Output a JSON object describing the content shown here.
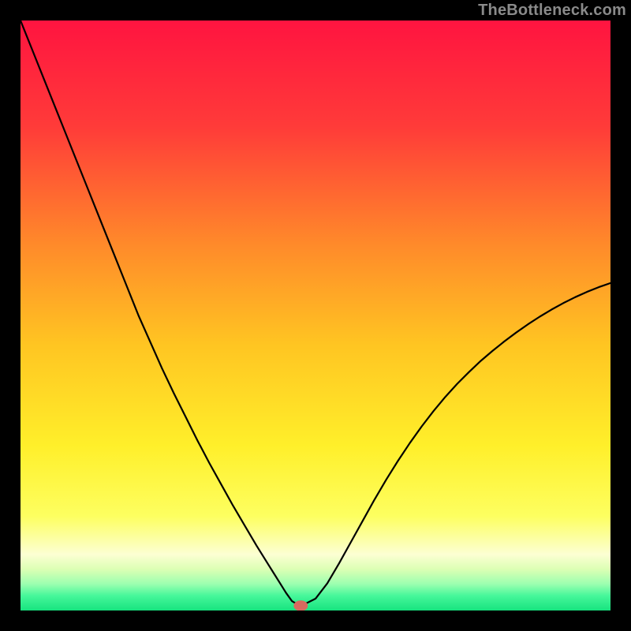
{
  "watermark": "TheBottleneck.com",
  "chart_data": {
    "type": "line",
    "title": "",
    "xlabel": "",
    "ylabel": "",
    "xlim": [
      0,
      100
    ],
    "ylim": [
      0,
      100
    ],
    "grid": false,
    "legend": false,
    "background_gradient_stops": [
      {
        "offset": 0.0,
        "color": "#ff1440"
      },
      {
        "offset": 0.18,
        "color": "#ff3b39"
      },
      {
        "offset": 0.38,
        "color": "#ff8a2a"
      },
      {
        "offset": 0.55,
        "color": "#ffc522"
      },
      {
        "offset": 0.72,
        "color": "#ffef2a"
      },
      {
        "offset": 0.84,
        "color": "#fdff60"
      },
      {
        "offset": 0.905,
        "color": "#fcffd3"
      },
      {
        "offset": 0.93,
        "color": "#dcffb4"
      },
      {
        "offset": 0.955,
        "color": "#9cffb0"
      },
      {
        "offset": 0.975,
        "color": "#46f79a"
      },
      {
        "offset": 1.0,
        "color": "#17e37f"
      }
    ],
    "series": [
      {
        "name": "bottleneck-curve",
        "stroke": "#000000",
        "stroke_width": 2.2,
        "x": [
          0.0,
          2,
          4,
          6,
          8,
          10,
          12,
          14,
          16,
          18,
          20,
          22,
          24,
          26,
          28,
          30,
          32,
          34,
          36,
          38,
          40,
          41,
          42,
          43,
          44,
          45,
          46,
          47,
          48,
          50,
          52,
          54,
          56,
          58,
          60,
          62,
          64,
          66,
          68,
          70,
          72,
          74,
          76,
          78,
          80,
          82,
          84,
          86,
          88,
          90,
          92,
          94,
          96,
          98,
          100
        ],
        "y": [
          100,
          95.0,
          90.0,
          85.0,
          80.0,
          75.0,
          70.0,
          65.0,
          60.0,
          55.0,
          50.0,
          45.5,
          41.0,
          36.8,
          32.8,
          28.8,
          25.0,
          21.4,
          17.8,
          14.4,
          11.0,
          9.4,
          7.8,
          6.2,
          4.6,
          3.0,
          1.6,
          1.0,
          1.0,
          2.0,
          4.6,
          8.0,
          11.6,
          15.2,
          18.8,
          22.2,
          25.4,
          28.4,
          31.2,
          33.8,
          36.2,
          38.4,
          40.4,
          42.3,
          44.0,
          45.6,
          47.1,
          48.5,
          49.8,
          51.0,
          52.1,
          53.1,
          54.0,
          54.8,
          55.5
        ]
      }
    ],
    "marker": {
      "name": "optimal-point",
      "x": 47.5,
      "y": 0.8,
      "rx": 1.2,
      "ry": 0.9,
      "fill": "#d86a5f"
    }
  }
}
